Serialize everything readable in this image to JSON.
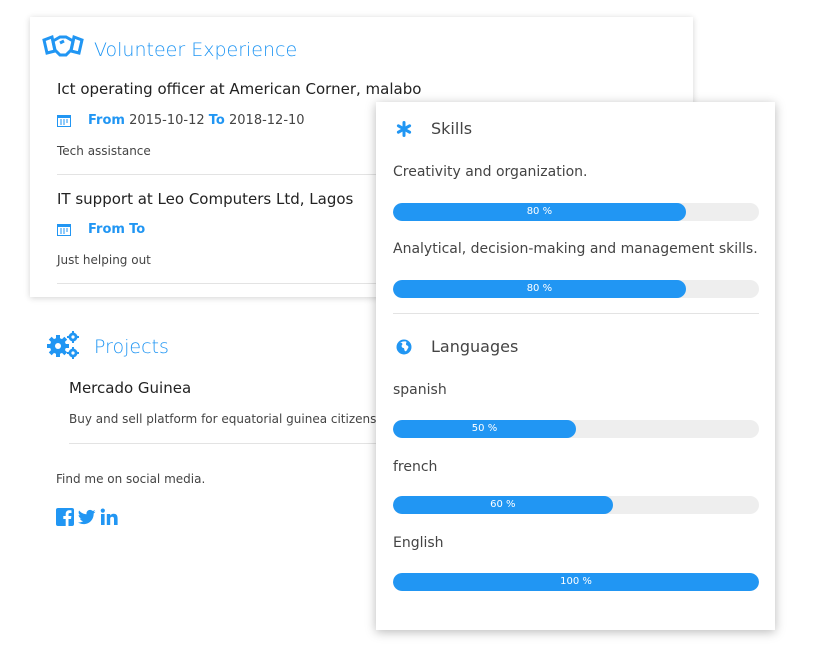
{
  "volunteer": {
    "title": "Volunteer Experience",
    "icon": "handshake-icon",
    "entries": [
      {
        "title": "Ict operating officer at American Corner, malabo",
        "from_label": "From",
        "from": "2015-10-12",
        "to_label": "To",
        "to": "2018-12-10",
        "description": "Tech assistance"
      },
      {
        "title": "IT support at Leo Computers Ltd, Lagos",
        "from_label": "From",
        "from": "",
        "to_label": "To",
        "to": "",
        "description": "Just helping out"
      }
    ]
  },
  "projects": {
    "title": "Projects",
    "icon": "cogs-icon",
    "items": [
      {
        "name": "Mercado Guinea",
        "description": "Buy and sell platform for equatorial guinea citizens"
      }
    ],
    "social_text": "Find me on social media.",
    "social": [
      "facebook-icon",
      "twitter-icon",
      "linkedin-icon"
    ]
  },
  "skills": {
    "title": "Skills",
    "icon": "asterisk-icon",
    "items": [
      {
        "name": "Creativity and organization.",
        "level": 80,
        "label": "80 %"
      },
      {
        "name": "Analytical, decision-making and management skills.",
        "level": 80,
        "label": "80 %"
      }
    ]
  },
  "languages": {
    "title": "Languages",
    "icon": "globe-icon",
    "items": [
      {
        "name": "spanish",
        "level": 50,
        "label": "50 %"
      },
      {
        "name": "french",
        "level": 60,
        "label": "60 %"
      },
      {
        "name": "English",
        "level": 100,
        "label": "100 %"
      }
    ]
  },
  "colors": {
    "accent": "#2196f3",
    "track": "#eeeeee"
  }
}
